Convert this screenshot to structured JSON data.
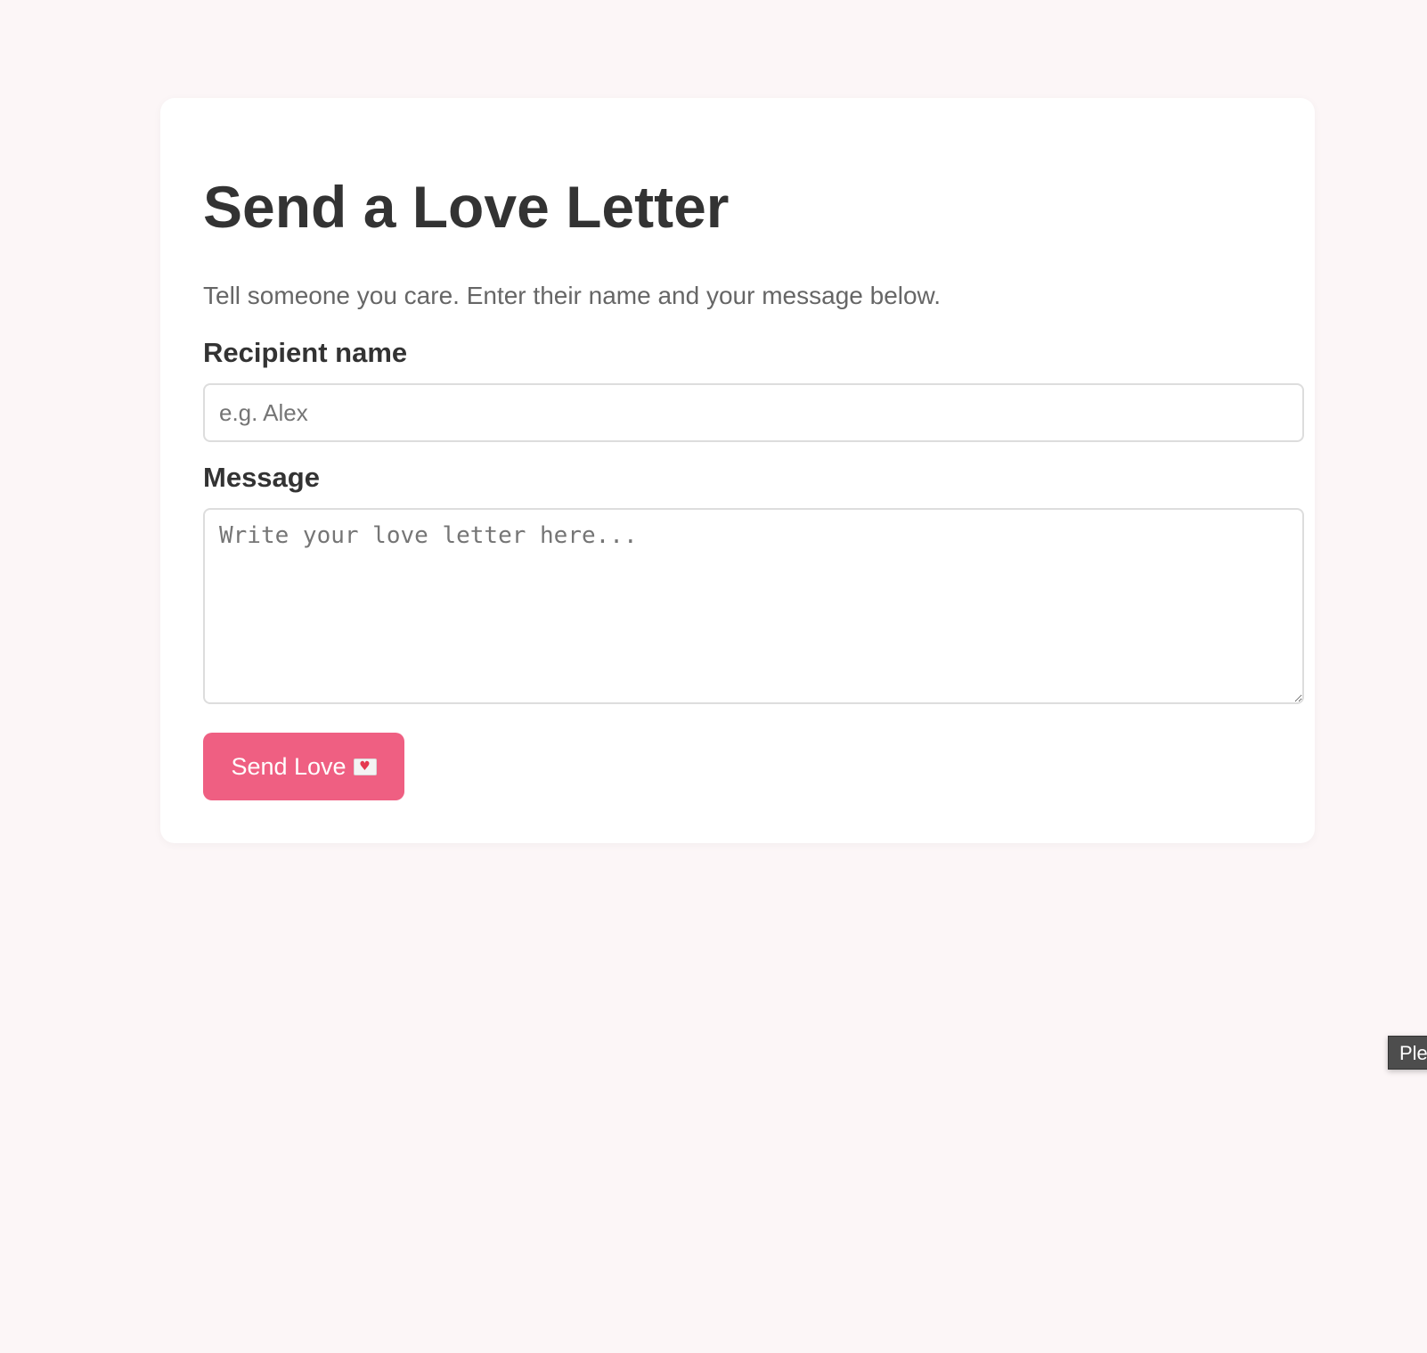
{
  "page": {
    "title": "Send a Love Letter",
    "subtitle": "Tell someone you care. Enter their name and your message below."
  },
  "form": {
    "recipient_label": "Recipient name",
    "recipient_placeholder": "e.g. Alex",
    "recipient_value": "",
    "message_label": "Message",
    "message_placeholder": "Write your love letter here...",
    "message_value": "",
    "submit_label": "Send Love",
    "submit_icon": "love-letter-icon"
  },
  "tooltip": {
    "text": "Ple"
  },
  "colors": {
    "background": "#fcf6f7",
    "card": "#ffffff",
    "accent": "#ef5f82",
    "text": "#333333",
    "muted_text": "#666666",
    "tooltip_bg": "#4d4d4d"
  }
}
